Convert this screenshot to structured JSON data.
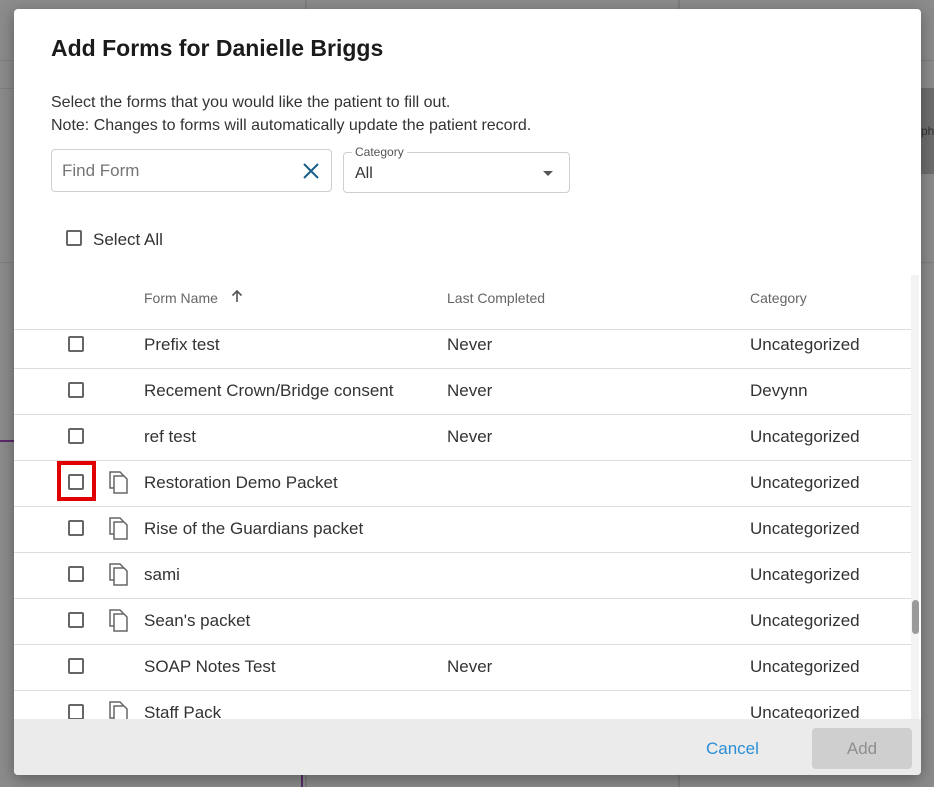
{
  "background": {
    "side_text": "ph"
  },
  "dialog": {
    "title": "Add Forms for Danielle Briggs",
    "description_line1": "Select the forms that you would like the patient to fill out.",
    "description_line2": "Note: Changes to forms will automatically update the patient record."
  },
  "search": {
    "placeholder": "Find Form",
    "value": ""
  },
  "category_filter": {
    "label": "Category",
    "value": "All"
  },
  "select_all": {
    "label": "Select All"
  },
  "table": {
    "headers": {
      "form_name": "Form Name",
      "last_completed": "Last Completed",
      "category": "Category"
    },
    "rows": [
      {
        "name": "Prefix test",
        "last_completed": "Never",
        "category": "Uncategorized",
        "packet": false
      },
      {
        "name": "Recement Crown/Bridge consent",
        "last_completed": "Never",
        "category": "Devynn",
        "packet": false
      },
      {
        "name": "ref test",
        "last_completed": "Never",
        "category": "Uncategorized",
        "packet": false
      },
      {
        "name": "Restoration Demo Packet",
        "last_completed": "",
        "category": "Uncategorized",
        "packet": true
      },
      {
        "name": "Rise of the Guardians packet",
        "last_completed": "",
        "category": "Uncategorized",
        "packet": true
      },
      {
        "name": "sami",
        "last_completed": "",
        "category": "Uncategorized",
        "packet": true
      },
      {
        "name": "Sean's packet",
        "last_completed": "",
        "category": "Uncategorized",
        "packet": true
      },
      {
        "name": "SOAP Notes Test",
        "last_completed": "Never",
        "category": "Uncategorized",
        "packet": false
      },
      {
        "name": "Staff Pack",
        "last_completed": "",
        "category": "Uncategorized",
        "packet": true
      }
    ]
  },
  "footer": {
    "cancel_label": "Cancel",
    "add_label": "Add"
  },
  "colors": {
    "accent": "#2a8fd6",
    "clear_icon": "#1a5f8a",
    "highlight": "#e00000",
    "disabled_button": "#cfcfcf"
  }
}
